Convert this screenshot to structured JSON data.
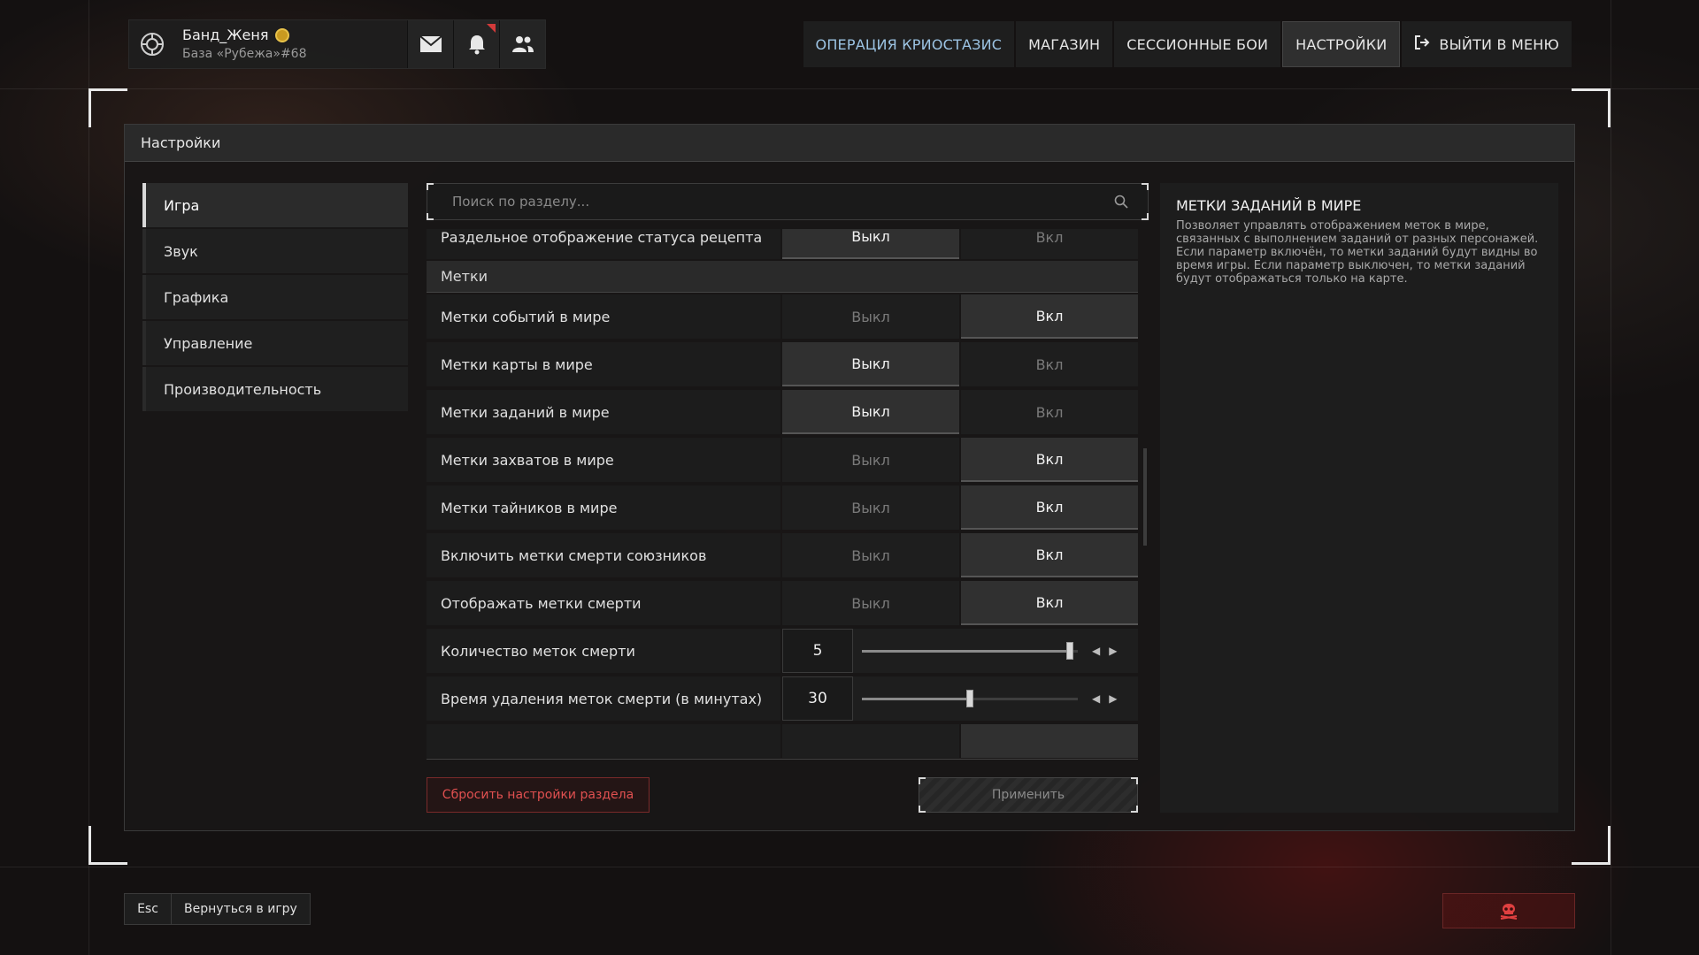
{
  "profile": {
    "username": "Банд_Женя",
    "base": "База «Рубежа»#68"
  },
  "topnav": {
    "tabs": [
      {
        "label": "ОПЕРАЦИЯ КРИОСТАЗИС"
      },
      {
        "label": "МАГАЗИН"
      },
      {
        "label": "СЕССИОННЫЕ БОИ"
      },
      {
        "label": "НАСТРОЙКИ"
      },
      {
        "label": "ВЫЙТИ В МЕНЮ"
      }
    ]
  },
  "panel": {
    "title": "Настройки"
  },
  "sidebar": {
    "items": [
      {
        "label": "Игра",
        "active": true
      },
      {
        "label": "Звук"
      },
      {
        "label": "Графика"
      },
      {
        "label": "Управление"
      },
      {
        "label": "Производительность"
      }
    ]
  },
  "search": {
    "placeholder": "Поиск по разделу..."
  },
  "settings": {
    "off_label": "Выкл",
    "on_label": "Вкл",
    "rows": [
      {
        "label": "Раздельное отображение статуса рецепта",
        "value": "Выкл"
      },
      {
        "label": "Метки",
        "section": true
      },
      {
        "label": "Метки событий в мире",
        "value": "Вкл"
      },
      {
        "label": "Метки карты в мире",
        "value": "Выкл"
      },
      {
        "label": "Метки заданий в мире",
        "value": "Выкл"
      },
      {
        "label": "Метки захватов в мире",
        "value": "Вкл"
      },
      {
        "label": "Метки тайников в мире",
        "value": "Вкл"
      },
      {
        "label": "Включить метки смерти союзников",
        "value": "Вкл"
      },
      {
        "label": "Отображать метки смерти",
        "value": "Вкл"
      },
      {
        "label": "Количество меток смерти",
        "number": "5",
        "slider_fraction": 0.98
      },
      {
        "label": "Время удаления меток смерти (в минутах)",
        "number": "30",
        "slider_fraction": 0.5
      }
    ]
  },
  "buttons": {
    "reset": "Сбросить настройки раздела",
    "apply": "Применить"
  },
  "description": {
    "title": "МЕТКИ ЗАДАНИЙ В МИРЕ",
    "text": "Позволяет управлять отображением меток в мире, связанных с выполнением заданий от разных персонажей. Если параметр включён, то метки заданий будут видны во время игры. Если параметр выключен, то метки заданий будут отображаться только на карте."
  },
  "footer": {
    "esc_key": "Esc",
    "back_label": "Вернуться в игру"
  },
  "colors": {
    "accent_blue": "#9cc4e4",
    "danger_red": "#e05050",
    "notification_red": "#d23a3a",
    "badge_gold": "#c99a20"
  }
}
